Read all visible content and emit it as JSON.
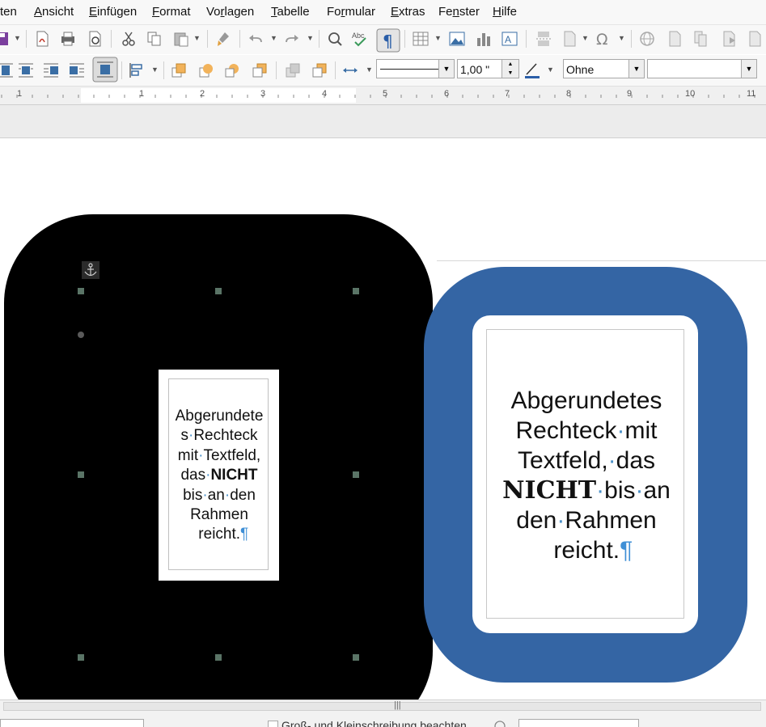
{
  "menubar": {
    "items": [
      {
        "label": "ten"
      },
      {
        "label": "Ansicht",
        "mnemonic": "A",
        "rest": "nsicht"
      },
      {
        "label": "Einfügen",
        "mnemonic": "E",
        "rest": "infügen"
      },
      {
        "label": "Format",
        "mnemonic": "F",
        "rest": "ormat"
      },
      {
        "label": "Vorlagen",
        "pre": "Vo",
        "mnemonic": "r",
        "rest": "lagen"
      },
      {
        "label": "Tabelle",
        "mnemonic": "T",
        "rest": "abelle"
      },
      {
        "label": "Formular",
        "pre": "Fo",
        "mnemonic": "r",
        "rest": "mular"
      },
      {
        "label": "Extras",
        "mnemonic": "E",
        "rest": "xtras"
      },
      {
        "label": "Fenster",
        "pre": "Fe",
        "mnemonic": "n",
        "rest": "ster"
      },
      {
        "label": "Hilfe",
        "mnemonic": "H",
        "rest": "ilfe"
      }
    ]
  },
  "toolbar2": {
    "line_width_value": "1,00 \"",
    "area_style_value": "Ohne",
    "area_fill_value": ""
  },
  "ruler": {
    "numbers": [
      "1",
      "1",
      "2",
      "3",
      "4",
      "5",
      "6",
      "7",
      "8",
      "9",
      "10",
      "11"
    ]
  },
  "document": {
    "left_textbox": {
      "lines": [
        "Abgerundete",
        "s Rechteck",
        "mit Textfeld,",
        "das NICHT",
        "bis an den",
        "Rahmen",
        "reicht."
      ],
      "part1": "Abgerundete",
      "part2": "s",
      "part3": "Rechteck",
      "part4": "mit",
      "part5": "Textfeld,",
      "part6": "das",
      "bold_word": "NICHT",
      "part7": "bis",
      "part8": "an",
      "part9": "den",
      "part10": "Rahmen",
      "part11": "reicht.",
      "pilcrow": "¶"
    },
    "right_textbox": {
      "part1": "Abgerundetes",
      "part2": "Rechteck",
      "part3": "mit",
      "part4": "Textfeld,",
      "part5": "das",
      "bold_word": "NICHT",
      "part6": "bis",
      "part7": "an",
      "part8": "den",
      "part9": "Rahmen",
      "part10": "reicht.",
      "pilcrow": "¶"
    }
  },
  "statusbar": {
    "match_case_label": "Groß- und Kleinschreibung beachten"
  },
  "colors": {
    "shape_left": "#000000",
    "shape_right": "#3465a4",
    "pilcrow": "#3f8fd6"
  }
}
